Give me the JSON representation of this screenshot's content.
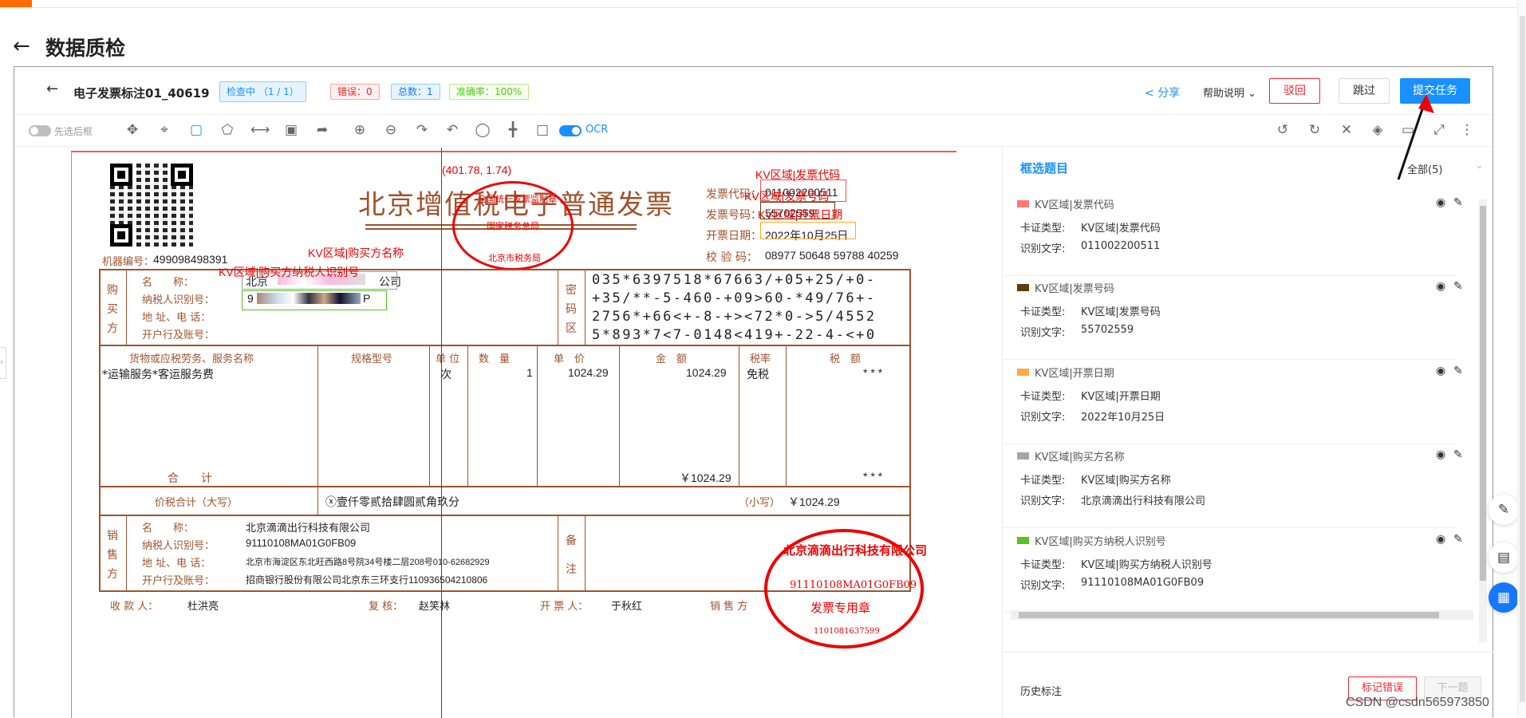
{
  "page": {
    "title": "数据质检",
    "watermark": "CSDN @csdn565973850"
  },
  "header": {
    "task_name": "电子发票标注01_40619",
    "status_tag": "检查中 （1 / 1）",
    "error_tag": "错误：0",
    "total_tag": "总数：1",
    "accuracy_tag": "准确率：100%",
    "share": "分享",
    "help": "帮助说明",
    "reject": "驳回",
    "skip": "跳过",
    "submit": "提交任务"
  },
  "toolbar": {
    "toggle_label": "先选后框",
    "ocr_label": "OCR"
  },
  "annotation": {
    "coord": "(401.78, 1.74)",
    "labels": [
      "KV区域|发票代码",
      "KV区域|发票号码",
      "KV区域|开票日期",
      "KV区域|购买方名称",
      "KV区域|购买方纳税人识别号"
    ],
    "colors": [
      "#ff4d4f",
      "#5c3d0e",
      "#faad14",
      "#999999",
      "#52c41a"
    ]
  },
  "invoice": {
    "title": "北京增值税电子普通发票",
    "code_label": "发票代码：",
    "code": "011002200511",
    "num_label": "发票号码：",
    "num": "55702559",
    "date_label": "开票日期：",
    "date": "2022年10月25日",
    "check_label": "校 验 码：",
    "check": "08977 50648 59788 40259",
    "machine_label": "机器编号：",
    "machine": "499098498391",
    "buyer_side": [
      "购",
      "买",
      "方"
    ],
    "buyer_labels": [
      "名　　称：",
      "纳税人识别号：",
      "地 址、电 话：",
      "开户行及账号："
    ],
    "buyer_name": "北京",
    "buyer_name_tail": "公司",
    "buyer_tax_head": "9",
    "buyer_tax_tail": "P",
    "cipher_side": [
      "密",
      "码",
      "区"
    ],
    "cipher": [
      "035*6397518*67663/+05+25/+0-",
      "+35/**-5-460-+09>60-*49/76+-",
      "2756*+66<+-8-+><72*0->5/4552",
      "5*893*7<7-0148<419+-22-4-<+0"
    ],
    "cols": [
      "货物或应税劳务、服务名称",
      "规格型号",
      "单 位",
      "数　量",
      "单　价",
      "金　额",
      "税率",
      "税　额"
    ],
    "item": {
      "name": "*运输服务*客运服务费",
      "unit": "次",
      "qty": "1",
      "price": "1024.29",
      "amount": "1024.29",
      "rate": "免税",
      "tax": "* * *"
    },
    "total_label": "合　　计",
    "total_amount": "￥1024.29",
    "total_tax": "* * *",
    "sum_label": "价税合计（大写）",
    "sum_upper": "ⓧ壹仟零贰拾肆圆贰角玖分",
    "sum_lower_label": "（小写）",
    "sum_lower": "￥1024.29",
    "seller_side": [
      "销",
      "售",
      "方"
    ],
    "seller_labels": [
      "名　　称：",
      "纳税人识别号：",
      "地 址、电 话：",
      "开户行及账号："
    ],
    "seller_name": "北京滴滴出行科技有限公司",
    "seller_tax": "91110108MA01G0FB09",
    "seller_addr": "北京市海淀区东北旺西路8号院34号楼二层208号010-62682929",
    "seller_bank": "招商银行股份有限公司北京东三环支行110936504210806",
    "remark_side": [
      "备",
      "注"
    ],
    "payee_label": "收 款 人：",
    "payee": "杜洪亮",
    "reviewer_label": "复 核：",
    "reviewer": "赵笑林",
    "drawer_label": "开 票 人：",
    "drawer": "于秋红",
    "seller_foot": "销 售 方",
    "stamp1": [
      "北京市税务局",
      "国家税务总局",
      "全国统一发票监制章"
    ],
    "stamp2": [
      "北京滴滴出行科技有限公司",
      "91110108MA01G0FB09",
      "发票专用章",
      "1101081637599"
    ]
  },
  "panel": {
    "title": "框选题目",
    "filter": "全部(5)",
    "type_label": "卡证类型:",
    "text_label": "识别文字:",
    "items": [
      {
        "name": "KV区域|发票代码",
        "type": "KV区域|发票代码",
        "text": "011002200511"
      },
      {
        "name": "KV区域|发票号码",
        "type": "KV区域|发票号码",
        "text": "55702559"
      },
      {
        "name": "KV区域|开票日期",
        "type": "KV区域|开票日期",
        "text": "2022年10月25日"
      },
      {
        "name": "KV区域|购买方名称",
        "type": "KV区域|购买方名称",
        "text": "北京滴滴出行科技有限公司"
      },
      {
        "name": "KV区域|购买方纳税人识别号",
        "type": "KV区域|购买方纳税人识别号",
        "text": "91110108MA01G0FB09"
      }
    ],
    "history": "历史标注",
    "mark_error": "标记错误",
    "next": "下一题"
  }
}
